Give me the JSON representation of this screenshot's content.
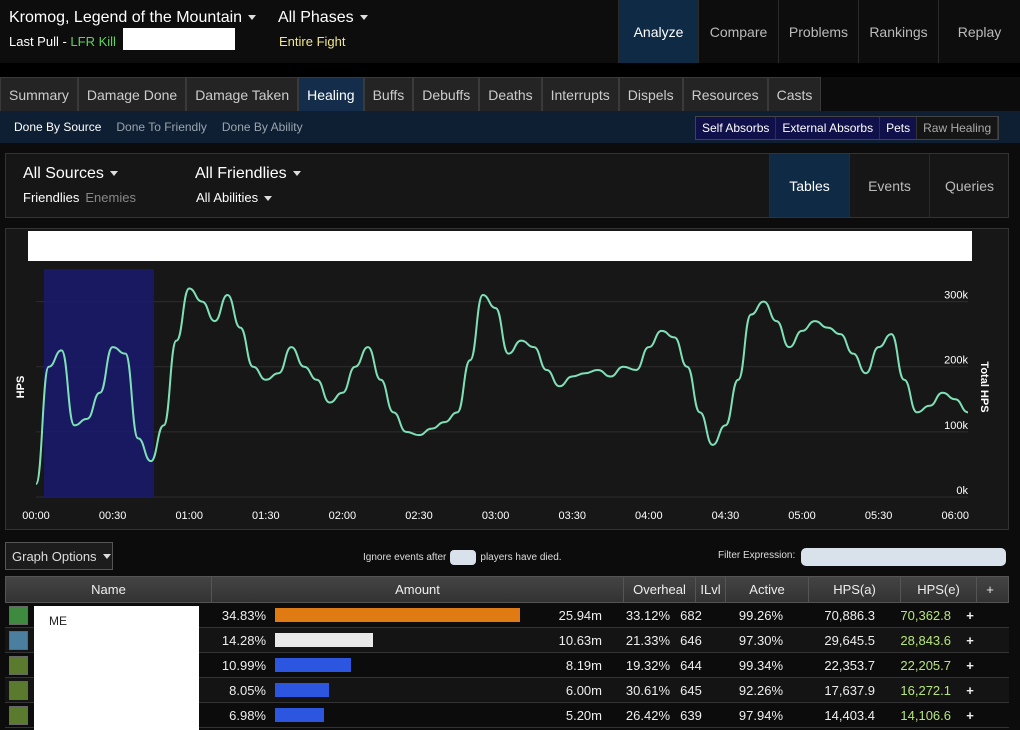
{
  "header": {
    "title": "Kromog, Legend of the Mountain",
    "last_pull_label": "Last Pull - ",
    "last_pull_value": "LFR Kill",
    "phases": "All Phases",
    "fight": "Entire Fight",
    "nav": [
      "Analyze",
      "Compare",
      "Problems",
      "Rankings",
      "Replay"
    ]
  },
  "tabs": [
    "Summary",
    "Damage Done",
    "Damage Taken",
    "Healing",
    "Buffs",
    "Debuffs",
    "Deaths",
    "Interrupts",
    "Dispels",
    "Resources",
    "Casts"
  ],
  "subtabs": [
    "Done By Source",
    "Done To Friendly",
    "Done By Ability"
  ],
  "toggles": [
    "Self Absorbs",
    "External Absorbs",
    "Pets",
    "Raw Healing"
  ],
  "filter": {
    "sources": "All Sources",
    "friendlies": "Friendlies",
    "enemies": "Enemies",
    "targets": "All Friendlies",
    "abilities": "All Abilities",
    "views": [
      "Tables",
      "Events",
      "Queries"
    ]
  },
  "graph": {
    "ylabel_left": "HPS",
    "ylabel_right": "Total HPS",
    "y_ticks": [
      "300k",
      "200k",
      "100k",
      "0k"
    ],
    "x_ticks": [
      "00:00",
      "00:30",
      "01:00",
      "01:30",
      "02:00",
      "02:30",
      "03:00",
      "03:30",
      "04:00",
      "04:30",
      "05:00",
      "05:30",
      "06:00"
    ]
  },
  "chart_data": {
    "type": "line",
    "xlabel": "",
    "ylabel": "HPS",
    "ylim": [
      0,
      350000
    ],
    "x_ticks": [
      "00:00",
      "00:30",
      "01:00",
      "01:30",
      "02:00",
      "02:30",
      "03:00",
      "03:30",
      "04:00",
      "04:30",
      "05:00",
      "05:30",
      "06:00"
    ],
    "highlight_range": [
      "00:00",
      "00:45"
    ],
    "series": [
      {
        "x": [
          0,
          5,
          10,
          15,
          20,
          25,
          30,
          35,
          40,
          45,
          50,
          55,
          60,
          65,
          70,
          75,
          80,
          85,
          90,
          95,
          100,
          105,
          110,
          115,
          120,
          125,
          130,
          135,
          140,
          145,
          150,
          155,
          160,
          165,
          170,
          175,
          180,
          185,
          190,
          195,
          200,
          205,
          210,
          215,
          220,
          225,
          230,
          235,
          240,
          245,
          250,
          255,
          260,
          265,
          270,
          275,
          280,
          285,
          290,
          295,
          300,
          305,
          310,
          315,
          320,
          325,
          330,
          335,
          340,
          345,
          350,
          355,
          360,
          365
        ],
        "values": [
          20000,
          200000,
          225000,
          110000,
          120000,
          160000,
          230000,
          220000,
          90000,
          55000,
          110000,
          240000,
          320000,
          300000,
          270000,
          310000,
          260000,
          200000,
          180000,
          190000,
          230000,
          200000,
          180000,
          145000,
          160000,
          200000,
          230000,
          180000,
          130000,
          100000,
          95000,
          105000,
          115000,
          130000,
          210000,
          310000,
          290000,
          220000,
          240000,
          230000,
          195000,
          170000,
          185000,
          190000,
          195000,
          185000,
          200000,
          195000,
          230000,
          255000,
          245000,
          200000,
          130000,
          80000,
          110000,
          180000,
          280000,
          300000,
          270000,
          230000,
          255000,
          270000,
          260000,
          250000,
          220000,
          190000,
          230000,
          250000,
          180000,
          130000,
          140000,
          160000,
          150000,
          130000
        ],
        "color": "#7fe0b8"
      }
    ]
  },
  "options": {
    "graph_options": "Graph Options",
    "ignore_before": "Ignore events after",
    "ignore_after": "players have died.",
    "filter_expression": "Filter Expression:"
  },
  "table": {
    "headers": [
      "Name",
      "Amount",
      "Overheal",
      "ILvl",
      "Active",
      "HPS(a)",
      "HPS(e)",
      "+"
    ],
    "visible_name": "ME",
    "rows": [
      {
        "pct": "34.83%",
        "bar": 0.9,
        "bar_color": "#e07b13",
        "total": "25.94m",
        "overheal": "33.12%",
        "ilvl": "682",
        "active": "99.26%",
        "hpsa": "70,886.3",
        "hpse": "70,362.8",
        "icon_color": "#3e8a3e"
      },
      {
        "pct": "14.28%",
        "bar": 0.36,
        "bar_color": "#e8e8e8",
        "total": "10.63m",
        "overheal": "21.33%",
        "ilvl": "646",
        "active": "97.30%",
        "hpsa": "29,645.5",
        "hpse": "28,843.6",
        "icon_color": "#4a7fa0"
      },
      {
        "pct": "10.99%",
        "bar": 0.28,
        "bar_color": "#2c55e0",
        "total": "8.19m",
        "overheal": "19.32%",
        "ilvl": "644",
        "active": "99.34%",
        "hpsa": "22,353.7",
        "hpse": "22,205.7",
        "icon_color": "#5a7a2e"
      },
      {
        "pct": "8.05%",
        "bar": 0.2,
        "bar_color": "#2c55e0",
        "total": "6.00m",
        "overheal": "30.61%",
        "ilvl": "645",
        "active": "92.26%",
        "hpsa": "17,637.9",
        "hpse": "16,272.1",
        "icon_color": "#5a7a2e"
      },
      {
        "pct": "6.98%",
        "bar": 0.18,
        "bar_color": "#2c55e0",
        "total": "5.20m",
        "overheal": "26.42%",
        "ilvl": "639",
        "active": "97.94%",
        "hpsa": "14,403.4",
        "hpse": "14,106.6",
        "icon_color": "#5a7a2e"
      }
    ]
  }
}
